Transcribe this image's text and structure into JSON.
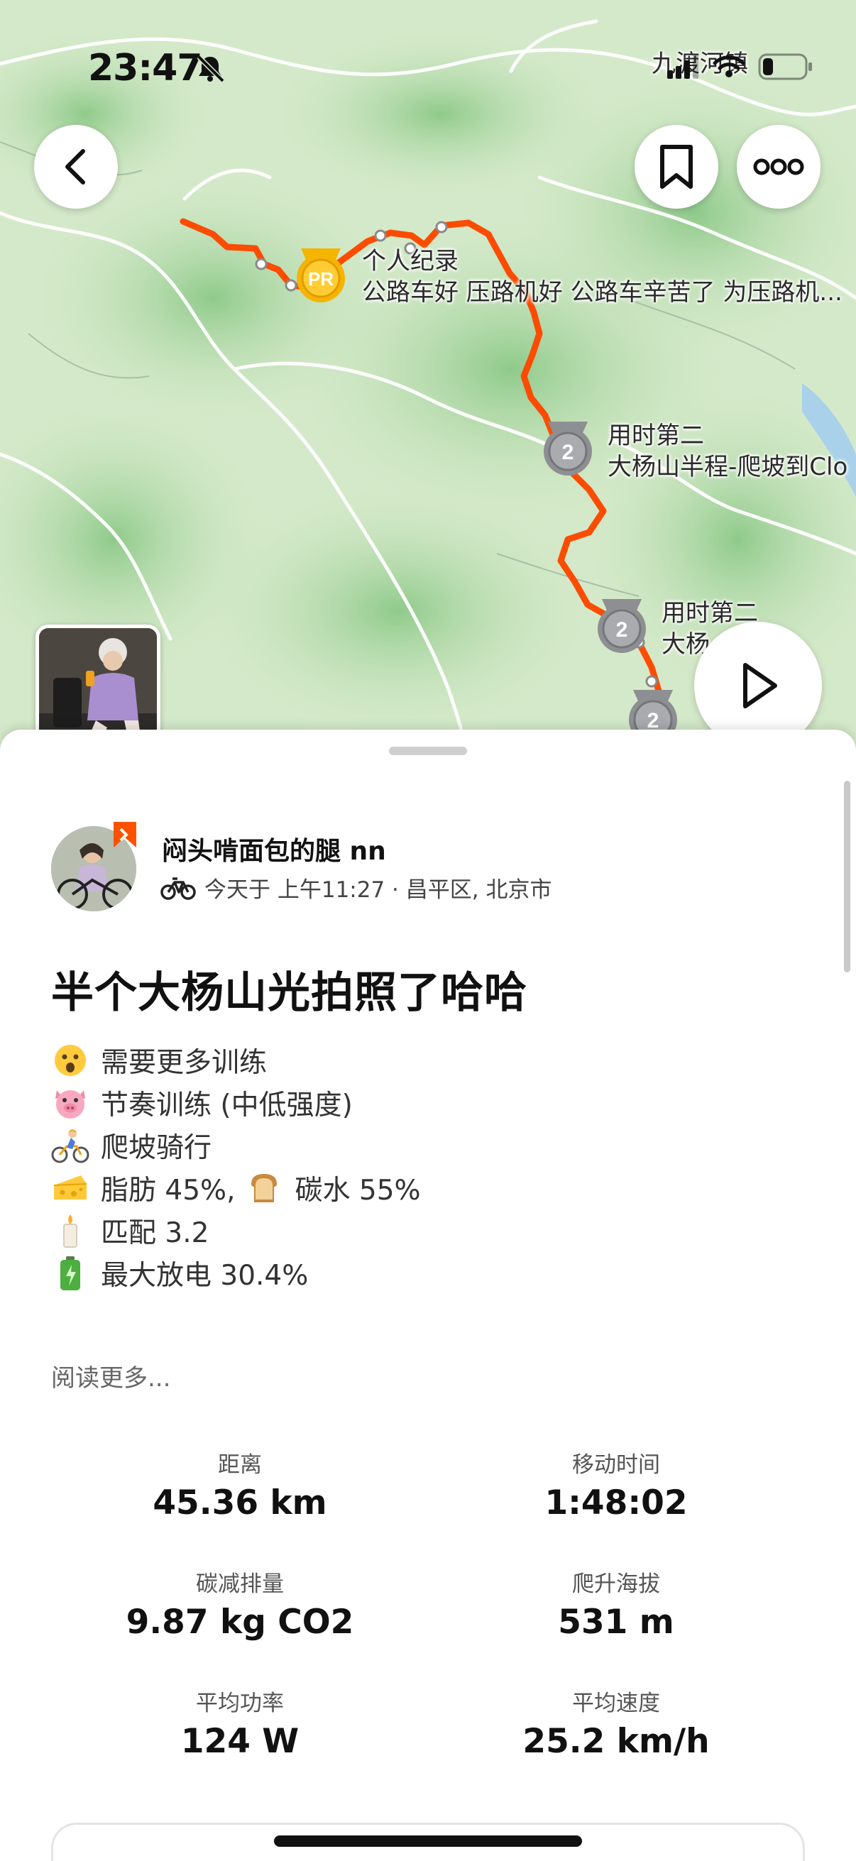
{
  "status": {
    "time": "23:47"
  },
  "map": {
    "town_label": "九渡河镇",
    "pr_badge": "PR",
    "pr_title": "个人纪录",
    "pr_segment": "公路车好 压路机好 公路车辛苦了 为压路机...",
    "second1_rank": "2",
    "second1_title": "用时第二",
    "second1_segment": "大杨山半程-爬坡到Clo",
    "second2_rank": "2",
    "second2_title": "用时第二",
    "second2_segment": "大杨",
    "second3_rank": "2"
  },
  "icons": {
    "back": "chevron-left-icon",
    "bookmark": "bookmark-icon",
    "more": "more-dots-icon",
    "play": "play-icon",
    "bike": "bike-icon"
  },
  "athlete": {
    "name": "闷头啃面包的腿 nn",
    "meta": "今天于 上午11:27 · 昌平区, 北京市"
  },
  "activity": {
    "title": "半个大杨山光拍照了哈哈",
    "description": [
      {
        "icon": "surprised-face-icon",
        "text": "需要更多训练"
      },
      {
        "icon": "pig-face-icon",
        "text": "节奏训练 (中低强度)"
      },
      {
        "icon": "cyclist-icon",
        "text": "爬坡骑行"
      },
      {
        "icon": "cheese-icon",
        "text": "脂肪 45%,",
        "icon2": "bread-icon",
        "text2": "碳水 55%"
      },
      {
        "icon": "candle-icon",
        "text": "匹配 3.2"
      },
      {
        "icon": "battery-icon",
        "text": "最大放电 30.4%"
      }
    ],
    "read_more": "阅读更多..."
  },
  "stats": [
    {
      "label": "距离",
      "value": "45.36 km"
    },
    {
      "label": "移动时间",
      "value": "1:48:02"
    },
    {
      "label": "碳减排量",
      "value": "9.87 kg CO2"
    },
    {
      "label": "爬升海拔",
      "value": "531 m"
    },
    {
      "label": "平均功率",
      "value": "124 W"
    },
    {
      "label": "平均速度",
      "value": "25.2 km/h"
    }
  ],
  "colors": {
    "route": "#fc4c02",
    "accent": "#fc5200",
    "pr_gold": "#f5b400",
    "medal_gray": "#8d8f93"
  }
}
